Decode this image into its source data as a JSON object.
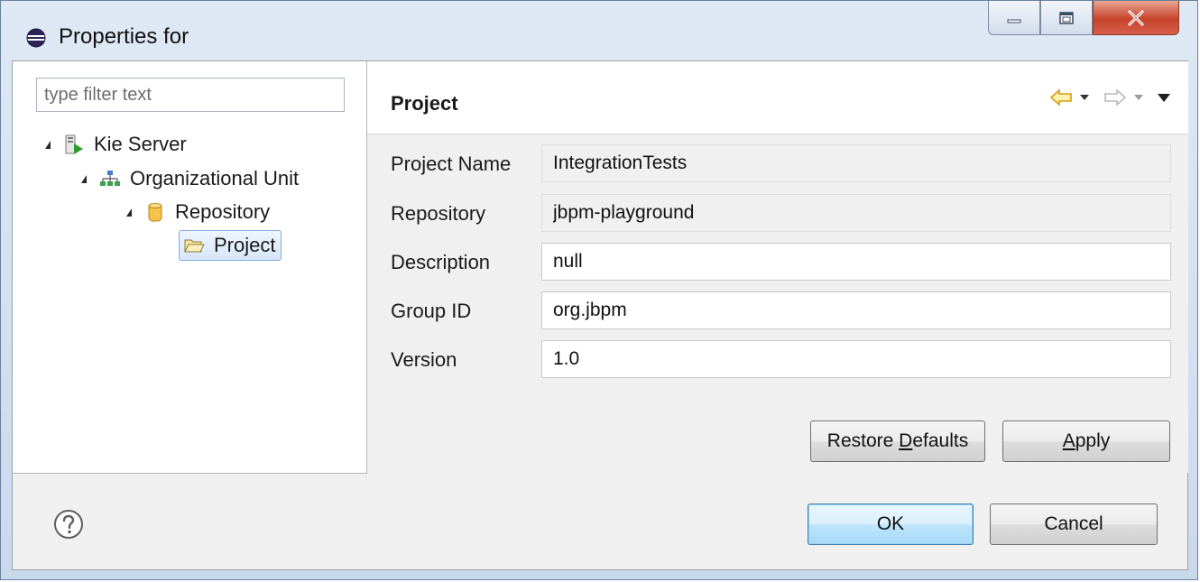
{
  "window": {
    "title": "Properties for",
    "icon": "eclipse-icon",
    "controls": [
      "minimize-icon",
      "maximize-icon",
      "close-icon"
    ]
  },
  "filter": {
    "placeholder": "type filter text",
    "value": ""
  },
  "tree": {
    "items": [
      {
        "label": "Kie Server",
        "icon": "server-icon",
        "expanded": true
      },
      {
        "label": "Organizational Unit",
        "icon": "org-unit-icon",
        "expanded": true
      },
      {
        "label": "Repository",
        "icon": "repository-icon",
        "expanded": true
      },
      {
        "label": "Project",
        "icon": "folder-open-icon",
        "selected": true
      }
    ]
  },
  "page": {
    "title": "Project",
    "nav_icons": [
      "back-arrow-icon",
      "back-menu-icon",
      "forward-arrow-icon",
      "forward-menu-icon",
      "view-menu-icon"
    ]
  },
  "fields": [
    {
      "label": "Project Name",
      "value": "IntegrationTests",
      "readonly": true
    },
    {
      "label": "Repository",
      "value": "jbpm-playground",
      "readonly": true
    },
    {
      "label": "Description",
      "value": "null",
      "readonly": false
    },
    {
      "label": "Group ID",
      "value": "org.jbpm",
      "readonly": false
    },
    {
      "label": "Version",
      "value": "1.0",
      "readonly": false
    }
  ],
  "buttons": {
    "restore_defaults_prefix": "Restore ",
    "restore_defaults_mnemonic": "D",
    "restore_defaults_suffix": "efaults",
    "apply_mnemonic": "A",
    "apply_suffix": "pply",
    "ok": "OK",
    "cancel": "Cancel"
  },
  "colors": {
    "titlebar": "#c9d9ec",
    "close_button": "#c7432b",
    "selection": "#d7e7fa",
    "default_button": "#bee6fd"
  }
}
